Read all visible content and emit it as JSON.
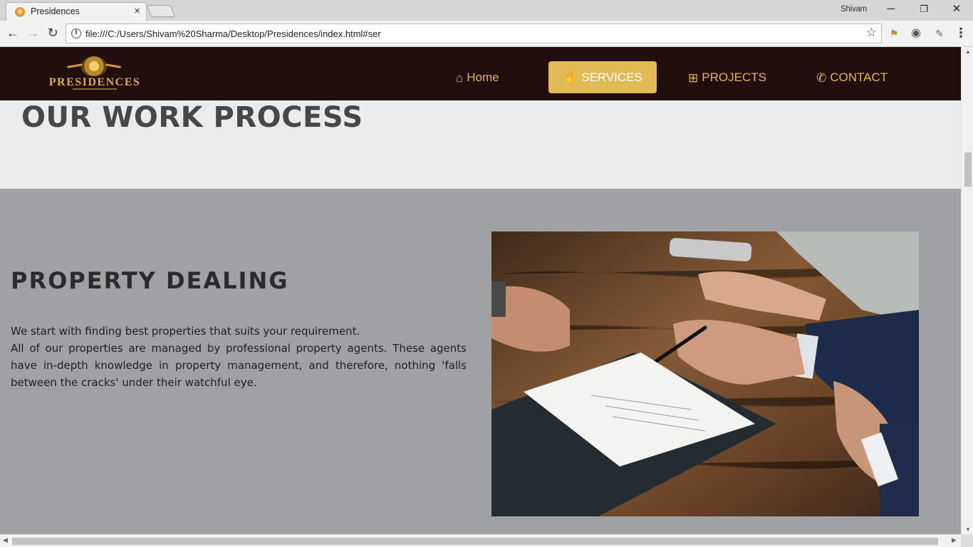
{
  "browser": {
    "tab_title": "Presidences",
    "tab_close": "×",
    "user_name": "Shivam",
    "window_buttons": {
      "minimize": "─",
      "restore": "❐",
      "close": "✕"
    },
    "nav": {
      "back": "←",
      "forward": "→",
      "reload": "↻"
    },
    "url": "file:///C:/Users/Shivam%20Sharma/Desktop/Presidences/index.html#ser",
    "info_glyph": "i",
    "star_glyph": "☆",
    "menu_glyph": "⋮"
  },
  "site": {
    "logo_text": "PRESIDENCES",
    "nav": [
      {
        "label": "Home",
        "icon": "home-icon",
        "glyph": "⌂"
      },
      {
        "label": "SERVICES",
        "icon": "handshake-icon",
        "glyph": "✋"
      },
      {
        "label": "PROJECTS",
        "icon": "sitemap-icon",
        "glyph": "⊞"
      },
      {
        "label": "CONTACT",
        "icon": "phone-icon",
        "glyph": "✆"
      }
    ],
    "active_nav": "SERVICES",
    "accent_color": "#e3bb56",
    "nav_bg_color": "#230e0e"
  },
  "work": {
    "title": "OUR WORK PROCESS"
  },
  "dealing": {
    "title": "PROPERTY DEALING",
    "paragraph_1": "We start with finding best properties that suits your requirement.",
    "paragraph_2": "All of our properties are managed by professional property agents. These agents have in-depth knowledge in property management, and therefore, nothing 'falls between the cracks' under their watchful eye."
  }
}
